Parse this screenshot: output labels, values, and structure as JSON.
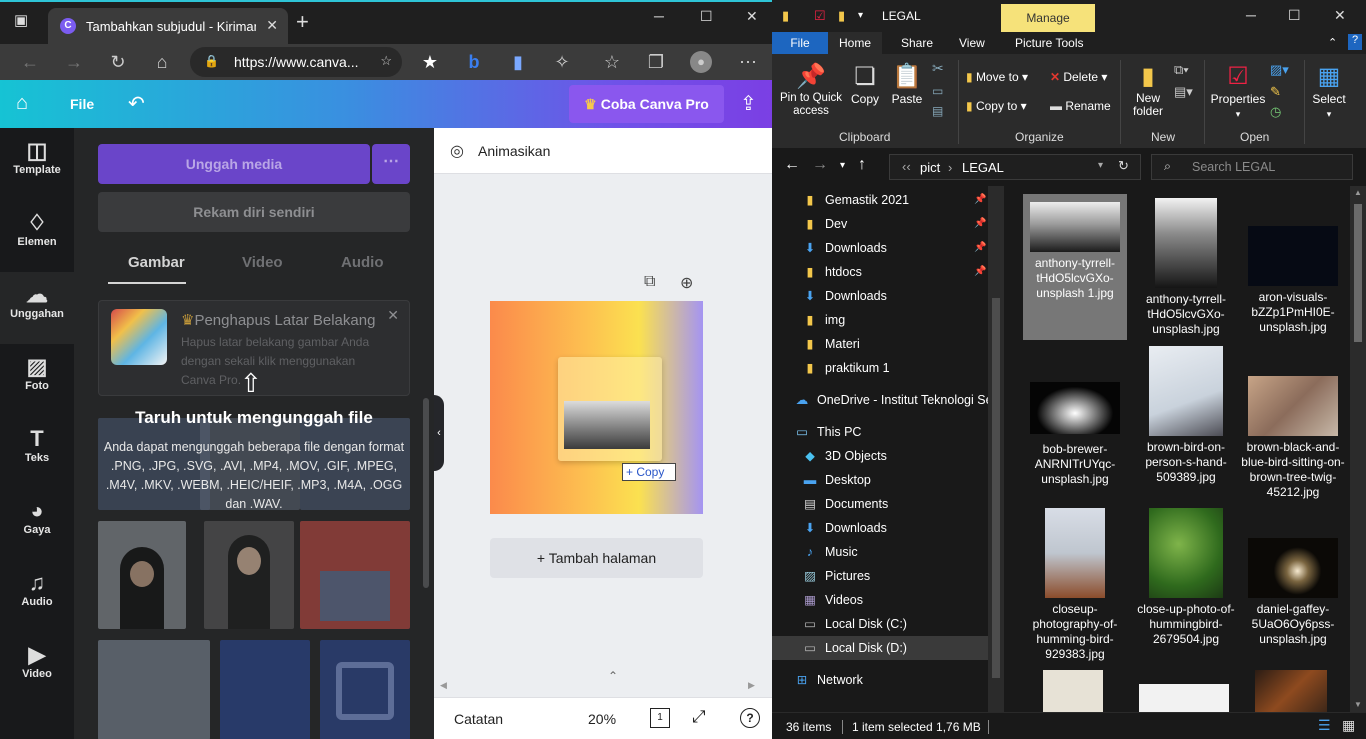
{
  "browser": {
    "tab_title": "Tambahkan subjudul - Kiriman In",
    "tab_favicon": "C",
    "url": "https://www.canva...",
    "controls": {
      "minimize": "─",
      "maximize": "☐",
      "close": "✕"
    }
  },
  "canva": {
    "file_label": "File",
    "pro_button": "Coba Canva Pro",
    "rail": [
      {
        "label": "Template",
        "icon": "template-icon"
      },
      {
        "label": "Elemen",
        "icon": "elements-icon"
      },
      {
        "label": "Unggahan",
        "icon": "upload-icon"
      },
      {
        "label": "Foto",
        "icon": "photo-icon"
      },
      {
        "label": "Teks",
        "icon": "text-icon"
      },
      {
        "label": "Gaya",
        "icon": "palette-icon"
      },
      {
        "label": "Audio",
        "icon": "audio-icon"
      },
      {
        "label": "Video",
        "icon": "video-icon"
      }
    ],
    "panel": {
      "upload_media": "Unggah media",
      "record_self": "Rekam diri sendiri",
      "tabs": [
        "Gambar",
        "Video",
        "Audio"
      ],
      "bg_remover_title": "Penghapus Latar Belakang",
      "bg_remover_desc": "Hapus latar belakang gambar Anda dengan sekali klik menggunakan Canva Pro.",
      "drop_title": "Taruh untuk mengunggah file",
      "drop_desc": "Anda dapat mengunggah beberapa file dengan format .PNG, .JPG, .SVG, .AVI, .MP4, .MOV, .GIF, .MPEG, .M4V, .MKV, .WEBM, .HEIC/HEIF, .MP3, .M4A, .OGG dan .WAV."
    },
    "editor": {
      "animate": "Animasikan",
      "copy_tag": "Copy",
      "add_page": "+ Tambah halaman",
      "notes": "Catatan",
      "zoom": "20%",
      "page_count": "1",
      "help": "?"
    }
  },
  "explorer": {
    "title": "LEGAL",
    "manage": "Manage",
    "tabs": [
      "File",
      "Home",
      "Share",
      "View",
      "Picture Tools"
    ],
    "ribbon": {
      "pin": "Pin to Quick access",
      "copy": "Copy",
      "paste": "Paste",
      "move_to": "Move to",
      "copy_to": "Copy to",
      "delete": "Delete",
      "rename": "Rename",
      "new_folder": "New folder",
      "properties": "Properties",
      "select": "Select",
      "groups": [
        "Clipboard",
        "Organize",
        "New",
        "Open"
      ]
    },
    "path": [
      "pict",
      "LEGAL"
    ],
    "search_placeholder": "Search LEGAL",
    "nav": [
      {
        "label": "Gemastik 2021",
        "icon": "folder-icon",
        "pinned": true
      },
      {
        "label": "Dev",
        "icon": "folder-icon",
        "pinned": true
      },
      {
        "label": "Downloads",
        "icon": "download-icon",
        "pinned": true
      },
      {
        "label": "htdocs",
        "icon": "folder-icon",
        "pinned": true
      },
      {
        "label": "Downloads",
        "icon": "download-icon",
        "pinned": false
      },
      {
        "label": "img",
        "icon": "folder-icon",
        "pinned": false
      },
      {
        "label": "Materi",
        "icon": "folder-icon",
        "pinned": false
      },
      {
        "label": "praktikum 1",
        "icon": "folder-icon",
        "pinned": false
      },
      {
        "label": "OneDrive - Institut Teknologi Sep",
        "icon": "cloud-icon",
        "pinned": false
      },
      {
        "label": "This PC",
        "icon": "pc-icon",
        "pinned": false
      },
      {
        "label": "3D Objects",
        "icon": "cube-icon",
        "pinned": false
      },
      {
        "label": "Desktop",
        "icon": "desktop-icon",
        "pinned": false
      },
      {
        "label": "Documents",
        "icon": "document-icon",
        "pinned": false
      },
      {
        "label": "Downloads",
        "icon": "download-icon",
        "pinned": false
      },
      {
        "label": "Music",
        "icon": "music-icon",
        "pinned": false
      },
      {
        "label": "Pictures",
        "icon": "pictures-icon",
        "pinned": false
      },
      {
        "label": "Videos",
        "icon": "videos-icon",
        "pinned": false
      },
      {
        "label": "Local Disk (C:)",
        "icon": "disk-icon",
        "pinned": false
      },
      {
        "label": "Local Disk (D:)",
        "icon": "disk-icon",
        "pinned": false
      },
      {
        "label": "Network",
        "icon": "network-icon",
        "pinned": false
      }
    ],
    "files": [
      {
        "name": "anthony-tyrrell-tHdO5lcvGXo-unsplash 1.jpg",
        "selected": true
      },
      {
        "name": "anthony-tyrrell-tHdO5lcvGXo-unsplash.jpg",
        "selected": false
      },
      {
        "name": "aron-visuals-bZZp1PmHI0E-unsplash.jpg",
        "selected": false
      },
      {
        "name": "bob-brewer-ANRNITrUYqc-unsplash.jpg",
        "selected": false
      },
      {
        "name": "brown-bird-on-person-s-hand-509389.jpg",
        "selected": false
      },
      {
        "name": "brown-black-and-blue-bird-sitting-on-brown-tree-twig-45212.jpg",
        "selected": false
      },
      {
        "name": "closeup-photography-of-humming-bird-929383.jpg",
        "selected": false
      },
      {
        "name": "close-up-photo-of-hummingbird-2679504.jpg",
        "selected": false
      },
      {
        "name": "daniel-gaffey-5UaO6Oy6pss-unsplash.jpg",
        "selected": false
      }
    ],
    "status": {
      "items": "36 items",
      "selected": "1 item selected  1,76 MB"
    }
  }
}
